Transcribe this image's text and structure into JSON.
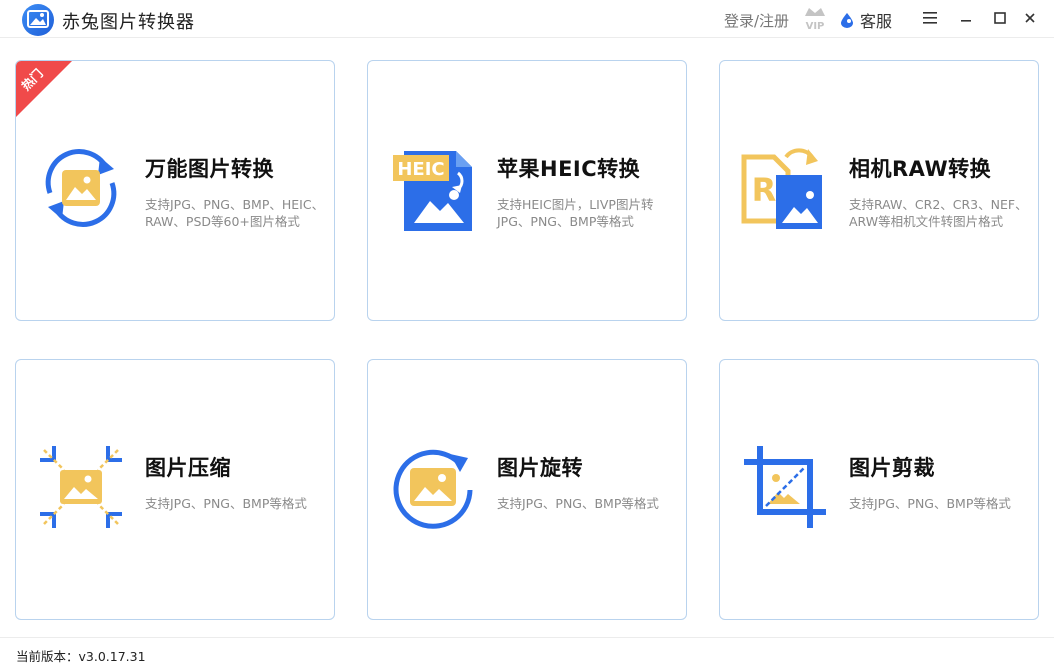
{
  "app": {
    "title": "赤兔图片转换器",
    "login_label": "登录/注册",
    "vip_label": "VIP",
    "service_label": "客服"
  },
  "cards": [
    {
      "title": "万能图片转换",
      "desc": "支持JPG、PNG、BMP、HEIC、RAW、PSD等60+图片格式",
      "badge": "热门",
      "icon": "image-convert-icon"
    },
    {
      "title": "苹果HEIC转换",
      "desc": "支持HEIC图片，LIVP图片转JPG、PNG、BMP等格式",
      "icon_text": "HEIC",
      "icon": "heic-file-icon"
    },
    {
      "title": "相机RAW转换",
      "desc": "支持RAW、CR2、CR3、NEF、ARW等相机文件转图片格式",
      "icon_text": "R",
      "icon": "raw-file-icon"
    },
    {
      "title": "图片压缩",
      "desc": "支持JPG、PNG、BMP等格式",
      "icon": "compress-icon"
    },
    {
      "title": "图片旋转",
      "desc": "支持JPG、PNG、BMP等格式",
      "icon": "rotate-icon"
    },
    {
      "title": "图片剪裁",
      "desc": "支持JPG、PNG、BMP等格式",
      "icon": "crop-icon"
    }
  ],
  "footer": {
    "version": "当前版本：v3.0.17.31"
  },
  "colors": {
    "blue": "#2c6ee8",
    "yellow": "#f2c55c",
    "red": "#f04a4a",
    "border": "#b9d3ee"
  }
}
